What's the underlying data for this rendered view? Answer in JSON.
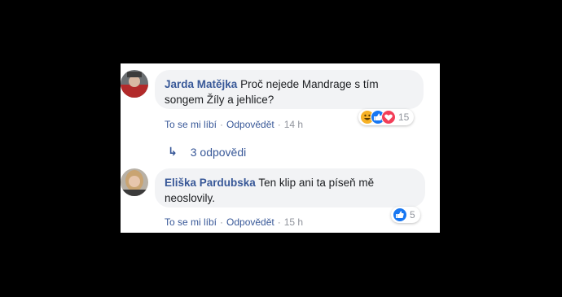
{
  "comments": [
    {
      "author": "Jarda Matějka",
      "text": "Proč nejede Mandrage s tím songem Žíly a jehlice?",
      "like_label": "To se mi líbí",
      "reply_label": "Odpovědět",
      "time": "14 h",
      "reaction_count": "15",
      "reactions": [
        "haha-icon",
        "like-icon",
        "love-icon"
      ]
    },
    {
      "author": "Eliška Pardubska",
      "text": "Ten klip ani ta píseň mě neoslovily.",
      "like_label": "To se mi líbí",
      "reply_label": "Odpovědět",
      "time": "15 h",
      "reaction_count": "5",
      "reactions": [
        "like-icon"
      ]
    }
  ],
  "replies_label": "3 odpovědi",
  "separator": "·",
  "colors": {
    "link": "#385898",
    "bubble": "#f2f3f5",
    "like": "#1877f2",
    "love": "#f33e58",
    "haha": "#f7b125"
  }
}
